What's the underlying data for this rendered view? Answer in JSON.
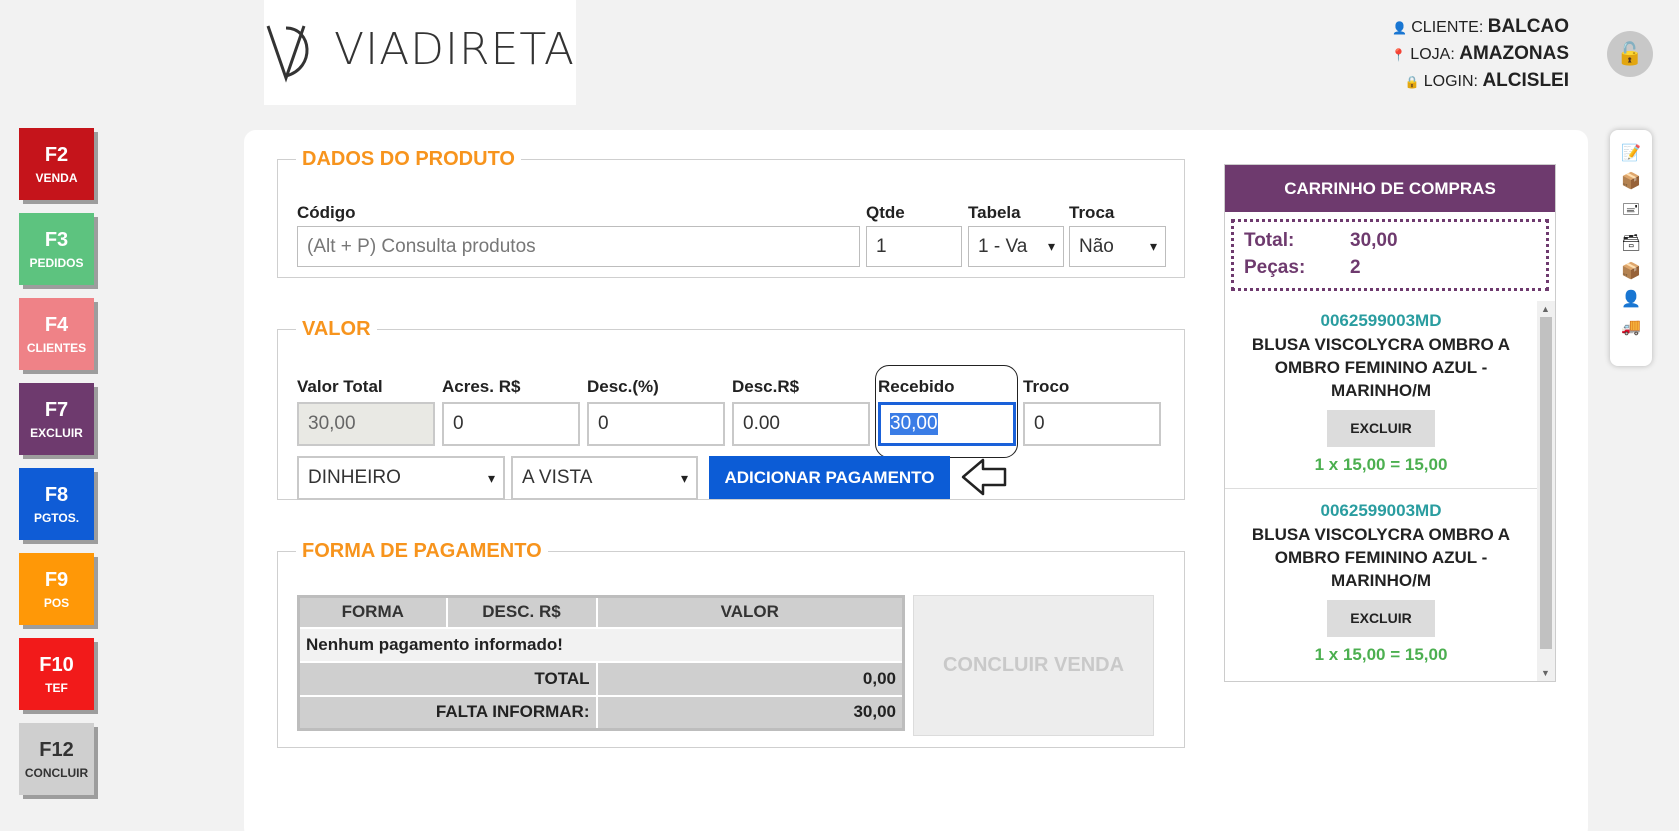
{
  "header": {
    "logo_text": "VIADIRETA",
    "cliente_label": "CLIENTE:",
    "cliente_value": "BALCAO",
    "loja_label": "LOJA:",
    "loja_value": "AMAZONAS",
    "login_label": "LOGIN:",
    "login_value": "ALCISLEI"
  },
  "fkeys": [
    {
      "key": "F2",
      "label": "VENDA",
      "color": "#c5141b"
    },
    {
      "key": "F3",
      "label": "PEDIDOS",
      "color": "#5dc37f"
    },
    {
      "key": "F4",
      "label": "CLIENTES",
      "color": "#ef8287"
    },
    {
      "key": "F7",
      "label": "EXCLUIR",
      "color": "#6e3a6e"
    },
    {
      "key": "F8",
      "label": "PGTOS.",
      "color": "#0f5cd6"
    },
    {
      "key": "F9",
      "label": "POS",
      "color": "#ff9807"
    },
    {
      "key": "F10",
      "label": "TEF",
      "color": "#f21a1a"
    },
    {
      "key": "F12",
      "label": "CONCLUIR",
      "color": "#cfcfcf"
    }
  ],
  "produto": {
    "legend": "DADOS DO PRODUTO",
    "codigo_label": "Código",
    "codigo_placeholder": "(Alt + P) Consulta produtos",
    "qtde_label": "Qtde",
    "qtde_value": "1",
    "tabela_label": "Tabela",
    "tabela_value": "1 - Va",
    "troca_label": "Troca",
    "troca_value": "Não"
  },
  "valor": {
    "legend": "VALOR",
    "valor_total_label": "Valor Total",
    "valor_total_value": "30,00",
    "acres_label": "Acres. R$",
    "acres_value": "0",
    "desc_pct_label": "Desc.(%)",
    "desc_pct_value": "0",
    "desc_rs_label": "Desc.R$",
    "desc_rs_value": "0.00",
    "recebido_label": "Recebido",
    "recebido_value": "30,00",
    "troco_label": "Troco",
    "troco_value": "0",
    "forma_select": "DINHEIRO",
    "condicao_select": "A VISTA",
    "add_button": "ADICIONAR PAGAMENTO"
  },
  "pagamento": {
    "legend": "FORMA DE PAGAMENTO",
    "columns": [
      "FORMA",
      "DESC. R$",
      "VALOR"
    ],
    "empty_message": "Nenhum pagamento informado!",
    "total_label": "TOTAL",
    "total_value": "0,00",
    "falta_label": "FALTA INFORMAR:",
    "falta_value": "30,00",
    "concluir_button": "CONCLUIR VENDA"
  },
  "cart": {
    "title": "CARRINHO DE COMPRAS",
    "total_label": "Total:",
    "total_value": "30,00",
    "pecas_label": "Peças:",
    "pecas_value": "2",
    "items": [
      {
        "code": "0062599003MD",
        "line1": "BLUSA VISCOLYCRA OMBRO A",
        "line2": "OMBRO FEMININO AZUL -",
        "line3": "MARINHO/M",
        "excluir": "EXCLUIR",
        "qty": "1 x 15,00 = 15,00"
      },
      {
        "code": "0062599003MD",
        "line1": "BLUSA VISCOLYCRA OMBRO A",
        "line2": "OMBRO FEMININO AZUL -",
        "line3": "MARINHO/M",
        "excluir": "EXCLUIR",
        "qty": "1 x 15,00 = 15,00"
      }
    ]
  },
  "tools": [
    "check-document-icon",
    "box-icon",
    "stamp-icon",
    "package-icon",
    "boxes-icon",
    "user-icon",
    "truck-icon"
  ]
}
